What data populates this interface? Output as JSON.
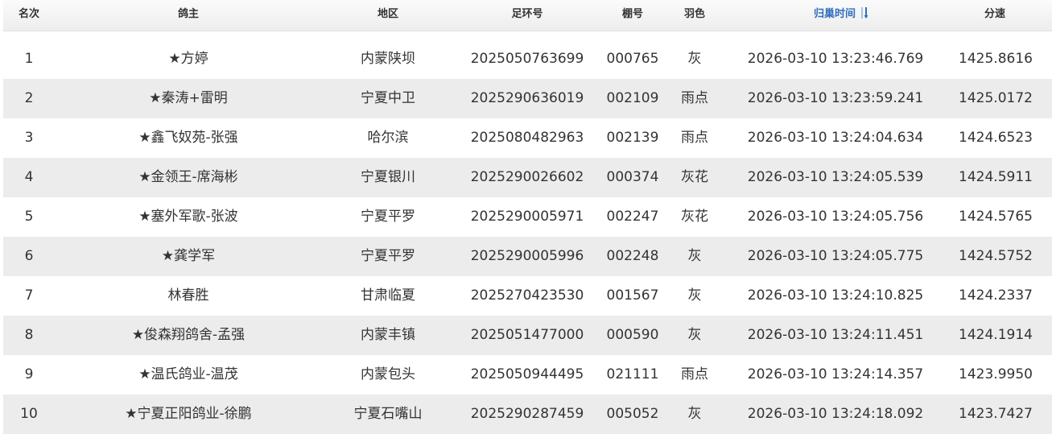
{
  "table": {
    "headers": {
      "rank": "名次",
      "owner": "鸽主",
      "region": "地区",
      "ring": "足环号",
      "loft": "棚号",
      "color": "羽色",
      "time": "归巢时间",
      "speed": "分速"
    },
    "sorted_column": "time",
    "sort_direction": "descending",
    "rows": [
      {
        "rank": "1",
        "owner": "★方婷",
        "region": "内蒙陕坝",
        "ring": "2025050763699",
        "loft": "000765",
        "color": "灰",
        "time": "2026-03-10 13:23:46.769",
        "speed": "1425.8616"
      },
      {
        "rank": "2",
        "owner": "★秦涛+雷明",
        "region": "宁夏中卫",
        "ring": "2025290636019",
        "loft": "002109",
        "color": "雨点",
        "time": "2026-03-10 13:23:59.241",
        "speed": "1425.0172"
      },
      {
        "rank": "3",
        "owner": "★鑫飞奴苑-张强",
        "region": "哈尔滨",
        "ring": "2025080482963",
        "loft": "002139",
        "color": "雨点",
        "time": "2026-03-10 13:24:04.634",
        "speed": "1424.6523"
      },
      {
        "rank": "4",
        "owner": "★金领王-席海彬",
        "region": "宁夏银川",
        "ring": "2025290026602",
        "loft": "000374",
        "color": "灰花",
        "time": "2026-03-10 13:24:05.539",
        "speed": "1424.5911"
      },
      {
        "rank": "5",
        "owner": "★塞外军歌-张波",
        "region": "宁夏平罗",
        "ring": "2025290005971",
        "loft": "002247",
        "color": "灰花",
        "time": "2026-03-10 13:24:05.756",
        "speed": "1424.5765"
      },
      {
        "rank": "6",
        "owner": "★龚学军",
        "region": "宁夏平罗",
        "ring": "2025290005996",
        "loft": "002248",
        "color": "灰",
        "time": "2026-03-10 13:24:05.775",
        "speed": "1424.5752"
      },
      {
        "rank": "7",
        "owner": "林春胜",
        "region": "甘肃临夏",
        "ring": "2025270423530",
        "loft": "001567",
        "color": "灰",
        "time": "2026-03-10 13:24:10.825",
        "speed": "1424.2337"
      },
      {
        "rank": "8",
        "owner": "★俊森翔鸽舍-孟强",
        "region": "内蒙丰镇",
        "ring": "2025051477000",
        "loft": "000590",
        "color": "灰",
        "time": "2026-03-10 13:24:11.451",
        "speed": "1424.1914"
      },
      {
        "rank": "9",
        "owner": "★温氏鸽业-温茂",
        "region": "内蒙包头",
        "ring": "2025050944495",
        "loft": "021111",
        "color": "雨点",
        "time": "2026-03-10 13:24:14.357",
        "speed": "1423.9950"
      },
      {
        "rank": "10",
        "owner": "★宁夏正阳鸽业-徐鹏",
        "region": "宁夏石嘴山",
        "ring": "2025290287459",
        "loft": "005052",
        "color": "灰",
        "time": "2026-03-10 13:24:18.092",
        "speed": "1423.7427"
      }
    ]
  },
  "colors": {
    "header_sorted": "#2f6ebd",
    "row_alt": "#ececec",
    "text": "#333333"
  }
}
